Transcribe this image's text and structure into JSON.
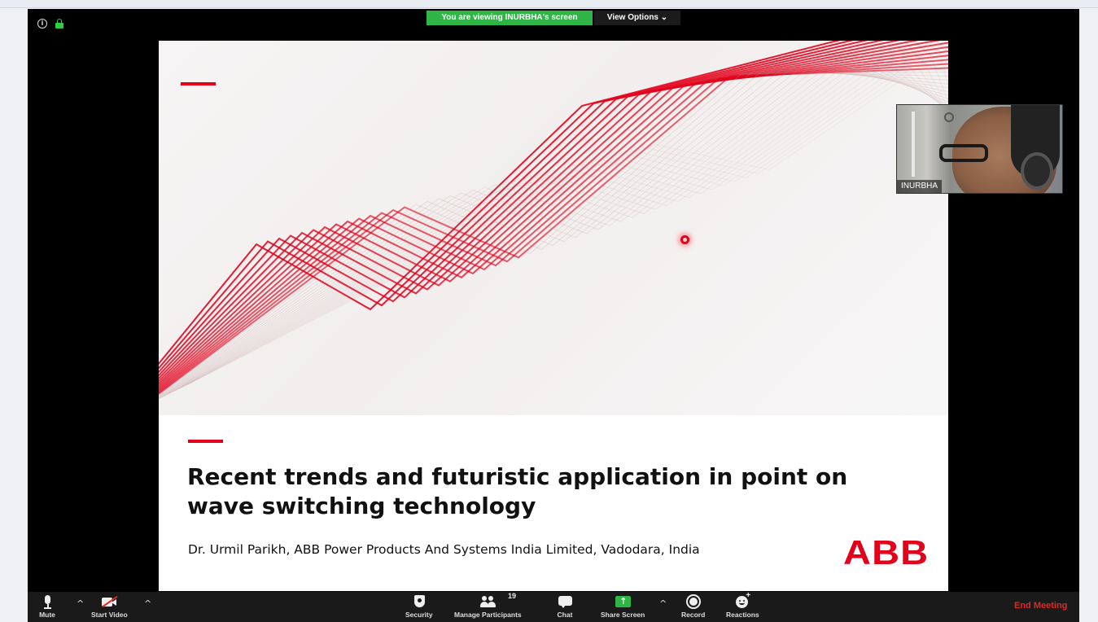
{
  "banner": {
    "viewing_text": "You are viewing INURBHA's screen",
    "view_options_label": "View Options ⌄"
  },
  "slide": {
    "title": "Recent trends and futuristic application in point on wave switching technology",
    "author": "Dr. Urmil Parikh, ABB Power Products And Systems India Limited, Vadodara, India",
    "logo_text": "ABB",
    "accent_color": "#e2001a"
  },
  "video": {
    "participant_name": "INURBHA"
  },
  "toolbar": {
    "mute_label": "Mute",
    "start_video_label": "Start Video",
    "security_label": "Security",
    "manage_participants_label": "Manage Participants",
    "participants_count": "19",
    "chat_label": "Chat",
    "share_screen_label": "Share Screen",
    "record_label": "Record",
    "reactions_label": "Reactions",
    "end_meeting_label": "End Meeting",
    "caret": "^"
  },
  "colors": {
    "toolbar_bg": "#1a1a1a",
    "share_green": "#2fb446",
    "end_red": "#e02828"
  }
}
